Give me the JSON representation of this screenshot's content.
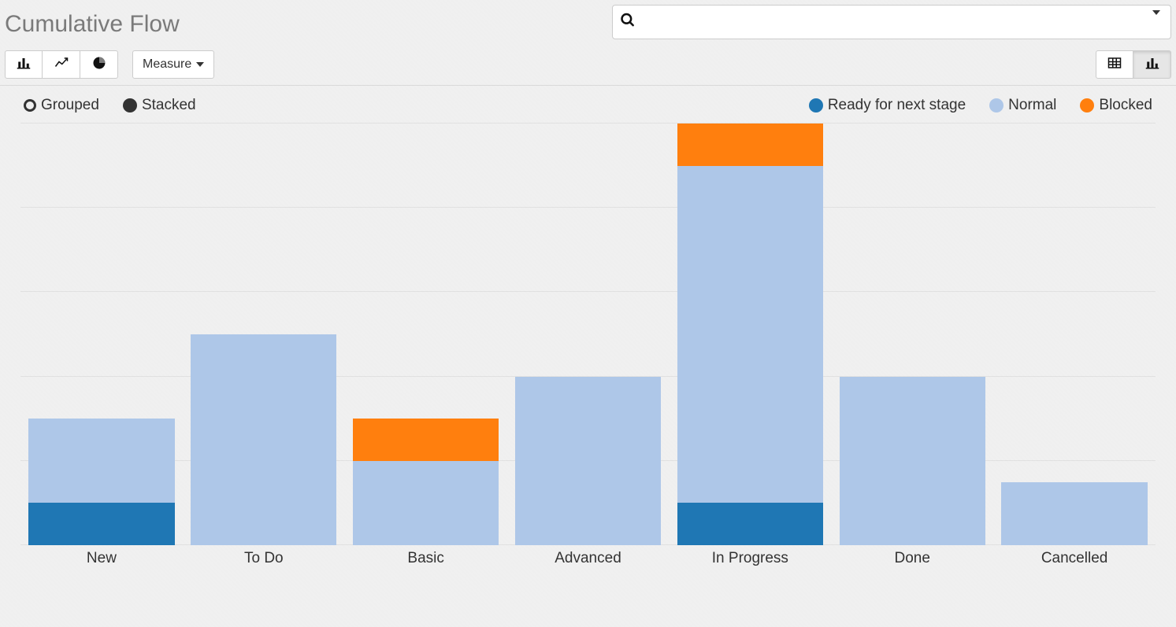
{
  "title": "Cumulative Flow",
  "search": {
    "placeholder": ""
  },
  "toolbar": {
    "measure_label": "Measure",
    "chart_types": {
      "bar": "bar-chart",
      "line": "line-chart",
      "pie": "pie-chart"
    },
    "view_modes": {
      "table": "table-view",
      "chart": "chart-view"
    }
  },
  "legend_modes": {
    "grouped": "Grouped",
    "stacked": "Stacked",
    "active": "stacked"
  },
  "legend_series": [
    {
      "id": "ready",
      "label": "Ready for next stage",
      "color": "#1f77b4"
    },
    {
      "id": "normal",
      "label": "Normal",
      "color": "#aec7e8"
    },
    {
      "id": "blocked",
      "label": "Blocked",
      "color": "#ff7f0e"
    }
  ],
  "chart_data": {
    "type": "bar",
    "stacked": true,
    "categories": [
      "New",
      "To Do",
      "Basic",
      "Advanced",
      "In Progress",
      "Done",
      "Cancelled"
    ],
    "series": [
      {
        "name": "Ready for next stage",
        "color": "#1f77b4",
        "values": [
          1,
          0,
          0,
          0,
          1,
          0,
          0
        ]
      },
      {
        "name": "Normal",
        "color": "#aec7e8",
        "values": [
          2,
          5,
          2,
          4,
          8,
          4,
          1.5
        ]
      },
      {
        "name": "Blocked",
        "color": "#ff7f0e",
        "values": [
          0,
          0,
          1,
          0,
          1,
          0,
          0
        ]
      }
    ],
    "title": "Cumulative Flow",
    "xlabel": "",
    "ylabel": "",
    "ylim": [
      0,
      10
    ],
    "gridlines": [
      0,
      2,
      4,
      6,
      8,
      10
    ]
  },
  "icons": {
    "search": "search-icon",
    "caret": "chevron-down-icon",
    "bar": "bar-chart-icon",
    "line": "line-chart-icon",
    "pie": "pie-chart-icon",
    "table": "table-icon",
    "chart": "bar-chart-icon"
  }
}
